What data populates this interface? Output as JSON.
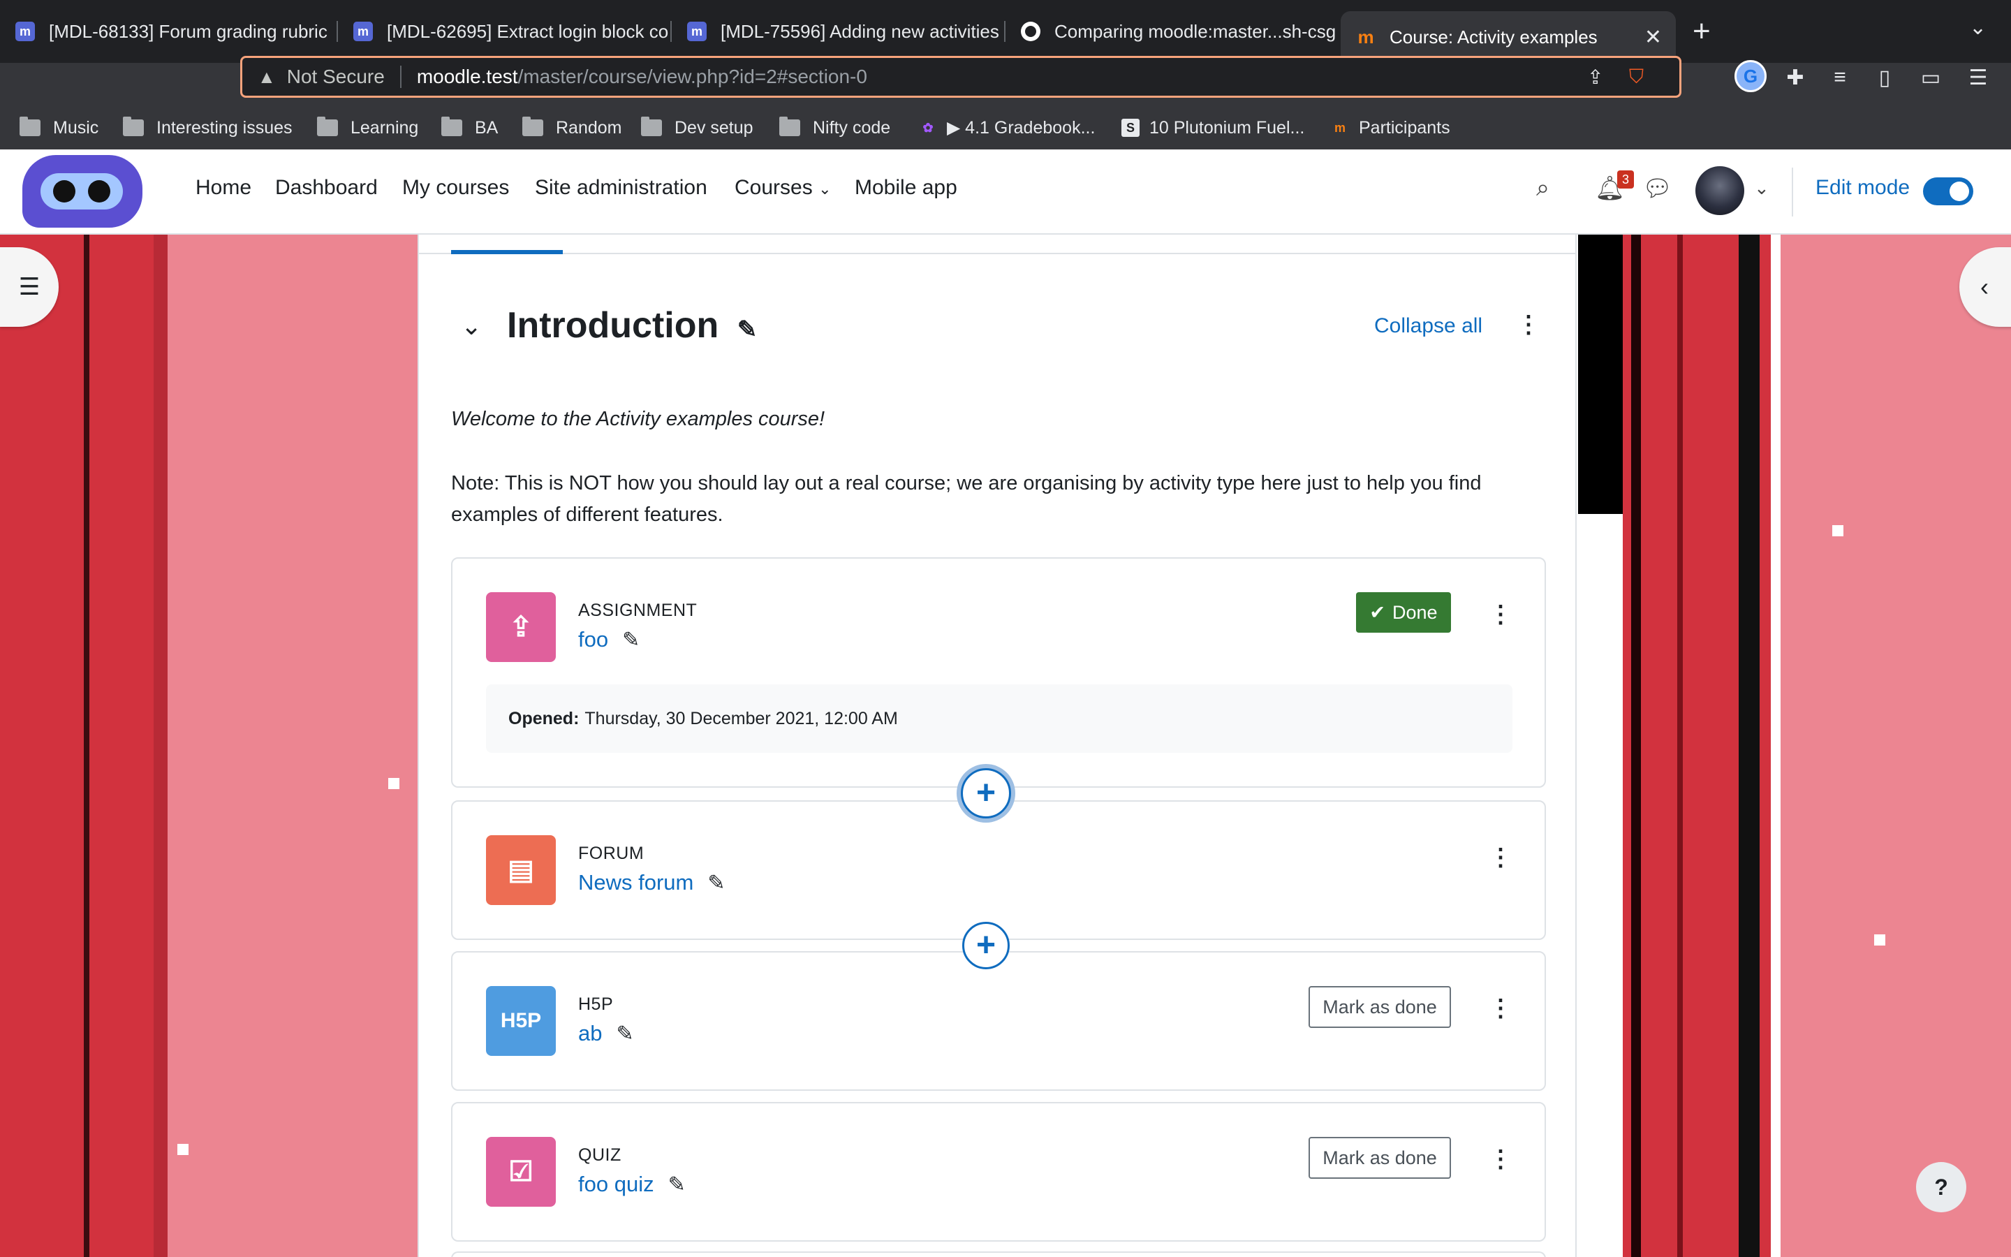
{
  "browser": {
    "tabs": [
      {
        "title": "[MDL-68133] Forum grading rubric",
        "favicon": "moodle-tracker-icon"
      },
      {
        "title": "[MDL-62695] Extract login block co",
        "favicon": "moodle-tracker-icon"
      },
      {
        "title": "[MDL-75596] Adding new activities",
        "favicon": "moodle-tracker-icon"
      },
      {
        "title": "Comparing moodle:master...sh-csg",
        "favicon": "github-icon"
      },
      {
        "title": "Course: Activity examples",
        "favicon": "moodle-icon",
        "active": true
      }
    ],
    "address": {
      "security": "Not Secure",
      "host": "moodle.test",
      "path": "/master/course/view.php?id=2#section-0"
    },
    "bookmarks": [
      {
        "label": "Music",
        "type": "folder"
      },
      {
        "label": "Interesting issues",
        "type": "folder"
      },
      {
        "label": "Learning",
        "type": "folder"
      },
      {
        "label": "BA",
        "type": "folder"
      },
      {
        "label": "Random",
        "type": "folder"
      },
      {
        "label": "Dev setup",
        "type": "folder"
      },
      {
        "label": "Nifty code",
        "type": "folder"
      },
      {
        "label": "▶ 4.1 Gradebook...",
        "type": "figma-icon"
      },
      {
        "label": "10 Plutonium Fuel...",
        "type": "s-icon"
      },
      {
        "label": "Participants",
        "type": "moodle-icon"
      }
    ]
  },
  "navbar": {
    "items": [
      "Home",
      "Dashboard",
      "My courses",
      "Site administration",
      "Courses",
      "Mobile app"
    ],
    "notification_count": "3",
    "edit_mode_label": "Edit mode",
    "edit_mode_on": true
  },
  "section": {
    "title": "Introduction",
    "collapse_all": "Collapse all",
    "welcome": "Welcome to the Activity examples course!",
    "note": "Note: This is NOT how you should lay out a real course; we are organising by activity type here just to help you find examples of different features."
  },
  "activities": [
    {
      "type": "ASSIGNMENT",
      "name": "foo",
      "color": "#f7634d",
      "icon": "assignment-upload-icon",
      "completion": "Done",
      "opened_label": "Opened:",
      "opened_value": "Thursday, 30 December 2021, 12:00 AM"
    },
    {
      "type": "FORUM",
      "name": "News forum",
      "color": "#f7634d",
      "icon": "forum-chat-icon"
    },
    {
      "type": "H5P",
      "name": "ab",
      "color": "#399be2",
      "icon": "h5p-icon",
      "icon_text": "H5P",
      "completion": "Mark as done"
    },
    {
      "type": "QUIZ",
      "name": "foo quiz",
      "color": "#eb66a2",
      "icon": "quiz-check-icon",
      "completion": "Mark as done"
    }
  ],
  "colors": {
    "primary": "#0f6cbf",
    "done": "#357a32",
    "assignment": "#e0609c",
    "forum": "#ed6d53",
    "h5p": "#4f9ce0",
    "quiz": "#e0609c"
  },
  "help": "?"
}
